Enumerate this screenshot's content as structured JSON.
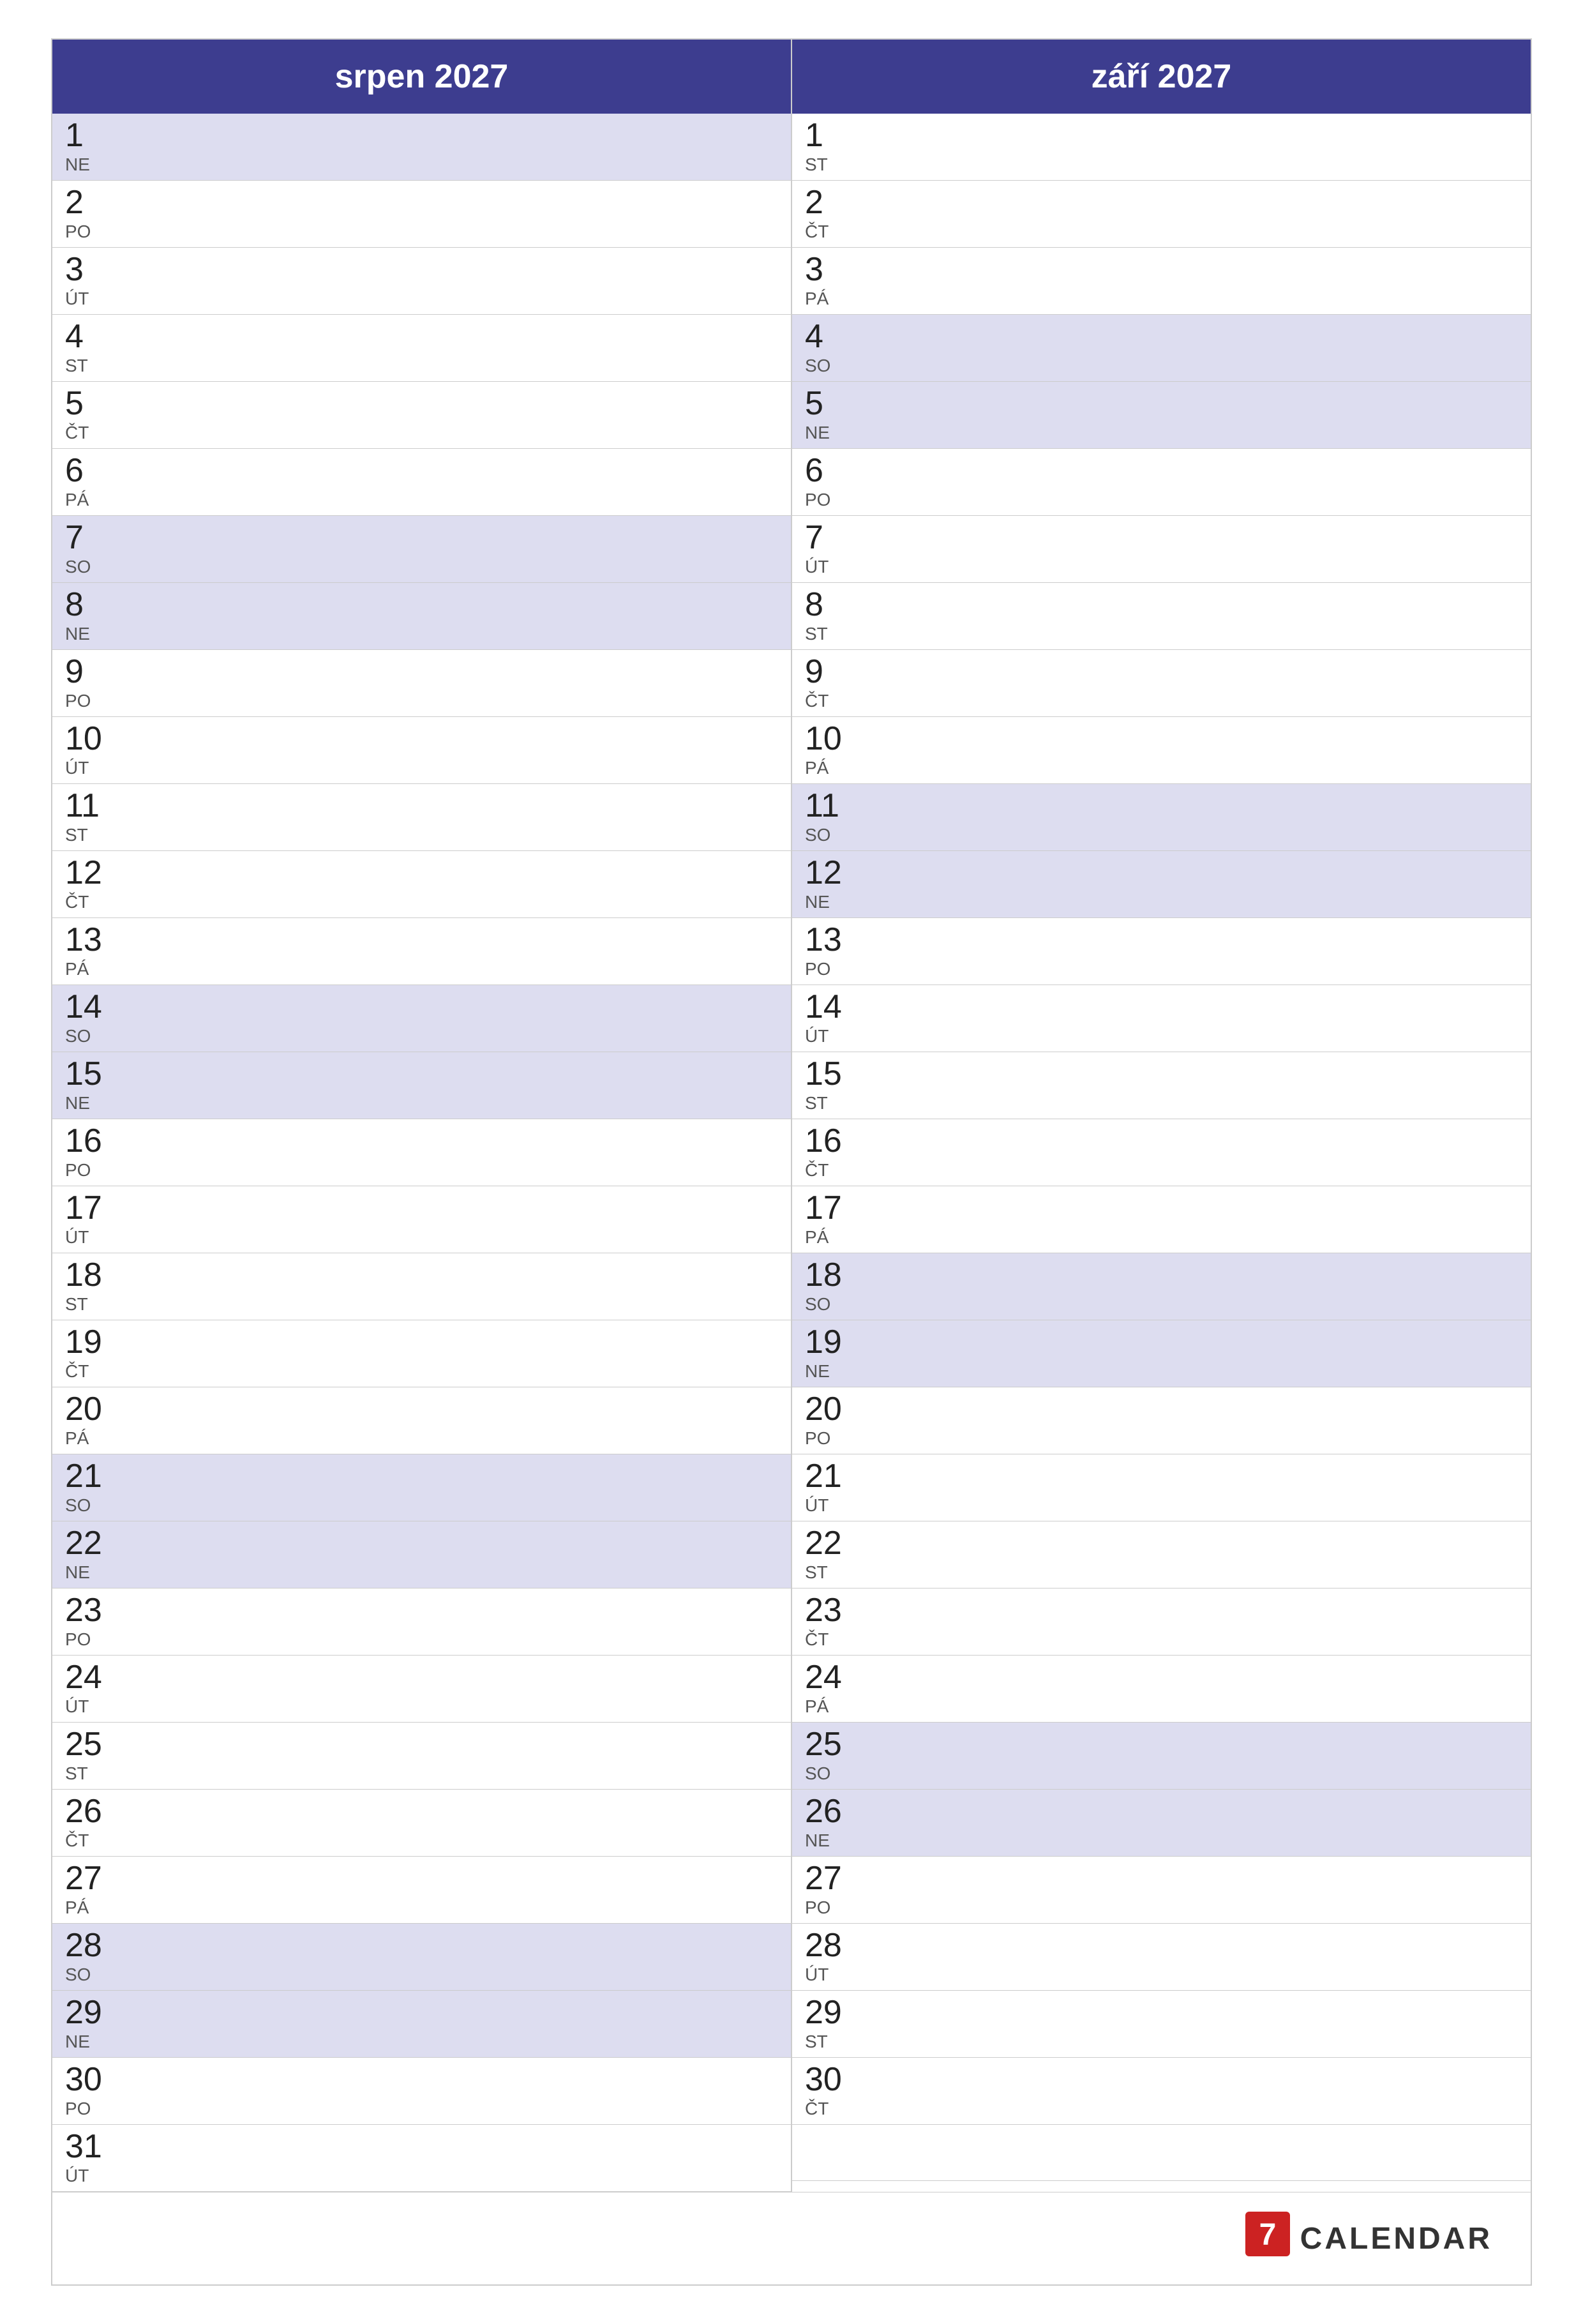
{
  "months": [
    {
      "title": "srpen 2027",
      "days": [
        {
          "number": "1",
          "name": "NE",
          "weekend": true
        },
        {
          "number": "2",
          "name": "PO",
          "weekend": false
        },
        {
          "number": "3",
          "name": "ÚT",
          "weekend": false
        },
        {
          "number": "4",
          "name": "ST",
          "weekend": false
        },
        {
          "number": "5",
          "name": "ČT",
          "weekend": false
        },
        {
          "number": "6",
          "name": "PÁ",
          "weekend": false
        },
        {
          "number": "7",
          "name": "SO",
          "weekend": true
        },
        {
          "number": "8",
          "name": "NE",
          "weekend": true
        },
        {
          "number": "9",
          "name": "PO",
          "weekend": false
        },
        {
          "number": "10",
          "name": "ÚT",
          "weekend": false
        },
        {
          "number": "11",
          "name": "ST",
          "weekend": false
        },
        {
          "number": "12",
          "name": "ČT",
          "weekend": false
        },
        {
          "number": "13",
          "name": "PÁ",
          "weekend": false
        },
        {
          "number": "14",
          "name": "SO",
          "weekend": true
        },
        {
          "number": "15",
          "name": "NE",
          "weekend": true
        },
        {
          "number": "16",
          "name": "PO",
          "weekend": false
        },
        {
          "number": "17",
          "name": "ÚT",
          "weekend": false
        },
        {
          "number": "18",
          "name": "ST",
          "weekend": false
        },
        {
          "number": "19",
          "name": "ČT",
          "weekend": false
        },
        {
          "number": "20",
          "name": "PÁ",
          "weekend": false
        },
        {
          "number": "21",
          "name": "SO",
          "weekend": true
        },
        {
          "number": "22",
          "name": "NE",
          "weekend": true
        },
        {
          "number": "23",
          "name": "PO",
          "weekend": false
        },
        {
          "number": "24",
          "name": "ÚT",
          "weekend": false
        },
        {
          "number": "25",
          "name": "ST",
          "weekend": false
        },
        {
          "number": "26",
          "name": "ČT",
          "weekend": false
        },
        {
          "number": "27",
          "name": "PÁ",
          "weekend": false
        },
        {
          "number": "28",
          "name": "SO",
          "weekend": true
        },
        {
          "number": "29",
          "name": "NE",
          "weekend": true
        },
        {
          "number": "30",
          "name": "PO",
          "weekend": false
        },
        {
          "number": "31",
          "name": "ÚT",
          "weekend": false
        }
      ]
    },
    {
      "title": "září 2027",
      "days": [
        {
          "number": "1",
          "name": "ST",
          "weekend": false
        },
        {
          "number": "2",
          "name": "ČT",
          "weekend": false
        },
        {
          "number": "3",
          "name": "PÁ",
          "weekend": false
        },
        {
          "number": "4",
          "name": "SO",
          "weekend": true
        },
        {
          "number": "5",
          "name": "NE",
          "weekend": true
        },
        {
          "number": "6",
          "name": "PO",
          "weekend": false
        },
        {
          "number": "7",
          "name": "ÚT",
          "weekend": false
        },
        {
          "number": "8",
          "name": "ST",
          "weekend": false
        },
        {
          "number": "9",
          "name": "ČT",
          "weekend": false
        },
        {
          "number": "10",
          "name": "PÁ",
          "weekend": false
        },
        {
          "number": "11",
          "name": "SO",
          "weekend": true
        },
        {
          "number": "12",
          "name": "NE",
          "weekend": true
        },
        {
          "number": "13",
          "name": "PO",
          "weekend": false
        },
        {
          "number": "14",
          "name": "ÚT",
          "weekend": false
        },
        {
          "number": "15",
          "name": "ST",
          "weekend": false
        },
        {
          "number": "16",
          "name": "ČT",
          "weekend": false
        },
        {
          "number": "17",
          "name": "PÁ",
          "weekend": false
        },
        {
          "number": "18",
          "name": "SO",
          "weekend": true
        },
        {
          "number": "19",
          "name": "NE",
          "weekend": true
        },
        {
          "number": "20",
          "name": "PO",
          "weekend": false
        },
        {
          "number": "21",
          "name": "ÚT",
          "weekend": false
        },
        {
          "number": "22",
          "name": "ST",
          "weekend": false
        },
        {
          "number": "23",
          "name": "ČT",
          "weekend": false
        },
        {
          "number": "24",
          "name": "PÁ",
          "weekend": false
        },
        {
          "number": "25",
          "name": "SO",
          "weekend": true
        },
        {
          "number": "26",
          "name": "NE",
          "weekend": true
        },
        {
          "number": "27",
          "name": "PO",
          "weekend": false
        },
        {
          "number": "28",
          "name": "ÚT",
          "weekend": false
        },
        {
          "number": "29",
          "name": "ST",
          "weekend": false
        },
        {
          "number": "30",
          "name": "ČT",
          "weekend": false
        }
      ]
    }
  ],
  "footer": {
    "logo_text": "CALENDAR",
    "logo_icon": "7"
  }
}
